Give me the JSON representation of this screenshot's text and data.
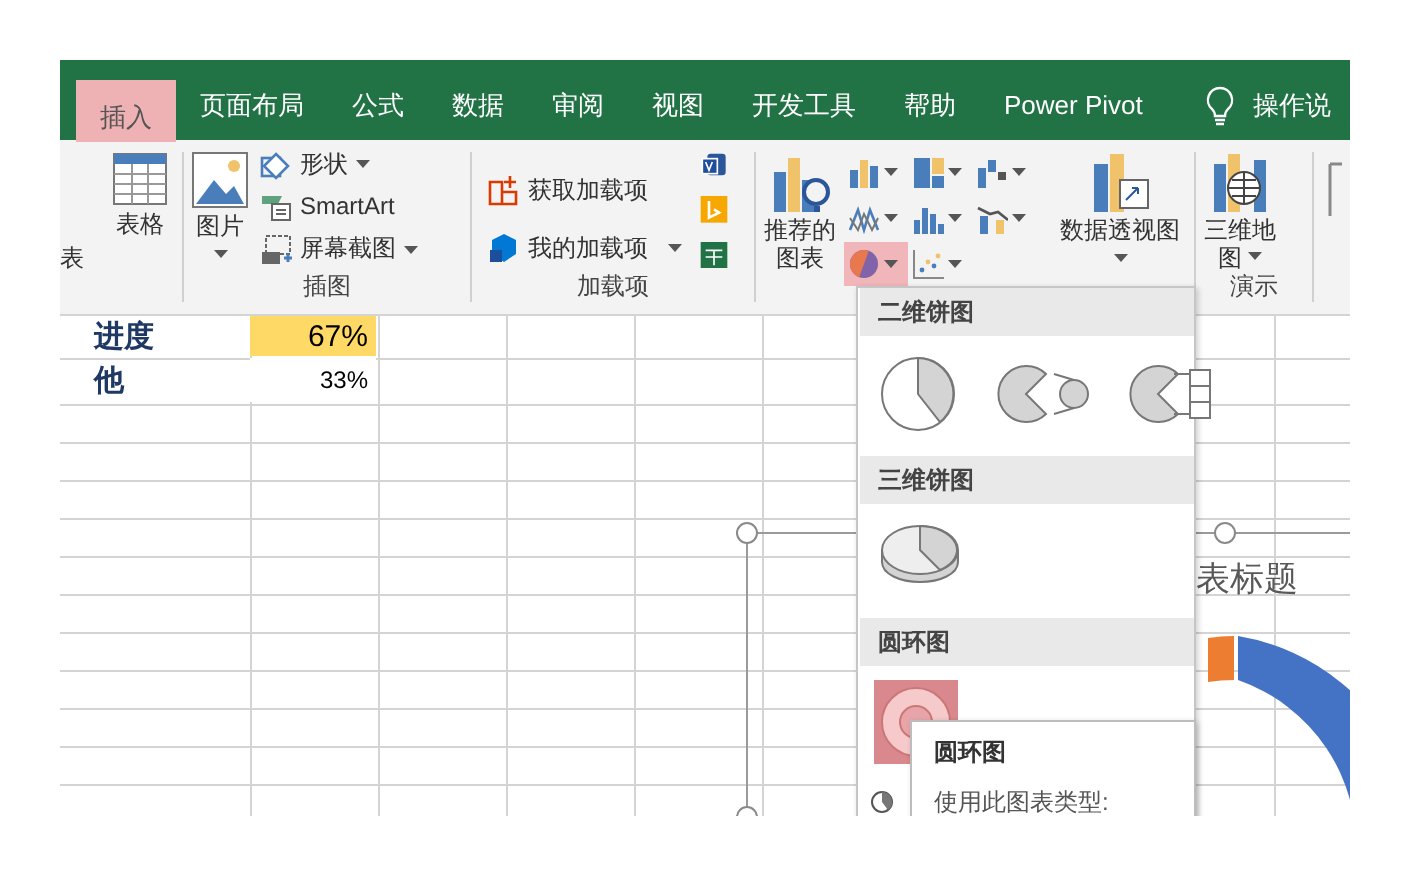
{
  "tabs": [
    {
      "label": "插入",
      "selected": true
    },
    {
      "label": "页面布局",
      "selected": false
    },
    {
      "label": "公式",
      "selected": false
    },
    {
      "label": "数据",
      "selected": false
    },
    {
      "label": "审阅",
      "selected": false
    },
    {
      "label": "视图",
      "selected": false
    },
    {
      "label": "开发工具",
      "selected": false
    },
    {
      "label": "帮助",
      "selected": false
    },
    {
      "label": "Power Pivot",
      "selected": false
    }
  ],
  "tell_me": {
    "label": "操作说"
  },
  "ribbon": {
    "cut_label": "表",
    "table_button": {
      "label": "表格"
    },
    "illustrations": {
      "pictures": {
        "label": "图片"
      },
      "small_buttons": [
        {
          "label": "形状",
          "dropdown": true
        },
        {
          "label": "SmartArt",
          "dropdown": false
        },
        {
          "label": "屏幕截图",
          "dropdown": true
        }
      ],
      "group_label": "插图"
    },
    "addins": {
      "buttons": [
        {
          "label": "获取加载项",
          "dropdown": false
        },
        {
          "label": "我的加载项",
          "dropdown": true
        }
      ],
      "group_label": "加载项"
    },
    "charts": {
      "recommended": {
        "label_lines": [
          "推荐的",
          "图表"
        ]
      },
      "chart_buttons": [
        {
          "selected": false
        },
        {
          "selected": false
        },
        {
          "selected": false
        },
        {
          "selected": false
        },
        {
          "selected": false
        },
        {
          "selected": false
        },
        {
          "selected": true
        },
        {
          "selected": false
        }
      ],
      "pivot_chart": {
        "label": "数据透视图"
      }
    },
    "tours": {
      "map": {
        "label_lines": [
          "三维地",
          "图"
        ]
      },
      "group_label": "演示"
    }
  },
  "sheet": {
    "rows": [
      {
        "label": "进度",
        "value": "67%",
        "kind": "big",
        "color": "#ffd966"
      },
      {
        "label": "他",
        "value": "33%",
        "kind": "small",
        "color": "#ffffff"
      }
    ]
  },
  "chart": {
    "title": "表标题"
  },
  "menu": {
    "sections": [
      {
        "title": "二维饼图",
        "items": [
          {
            "selected": false
          },
          {
            "selected": false
          },
          {
            "selected": false
          }
        ]
      },
      {
        "title": "三维饼图",
        "items": [
          {
            "selected": false
          }
        ]
      },
      {
        "title": "圆环图",
        "items": [
          {
            "selected": true
          }
        ]
      }
    ]
  },
  "tooltip": {
    "title": "圆环图",
    "text": "使用此图表类型:"
  }
}
